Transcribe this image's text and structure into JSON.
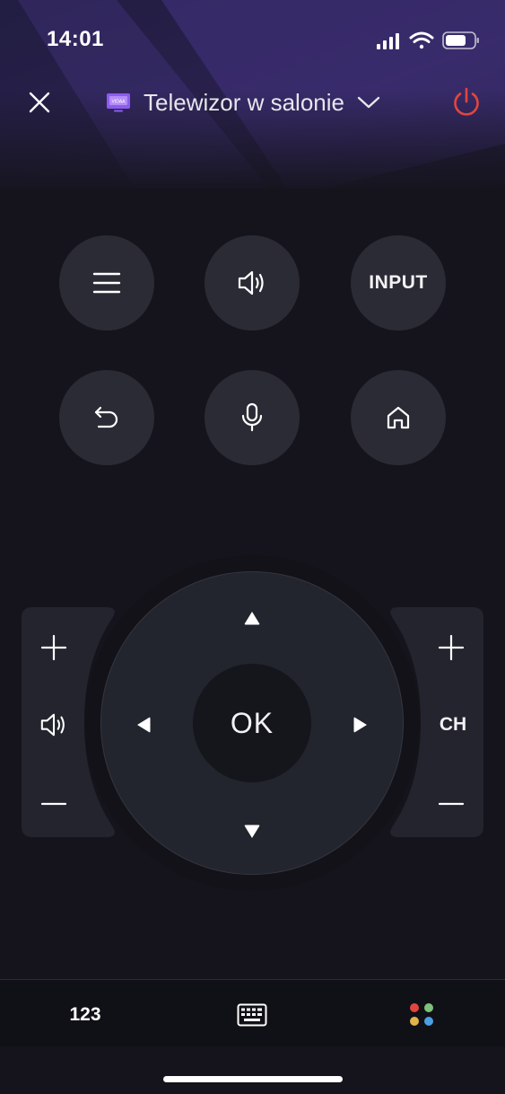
{
  "status_bar": {
    "time": "14:01"
  },
  "header": {
    "device_name": "Telewizor w salonie",
    "tv_icon_text": "VIDAA",
    "power_color": "#e0463f"
  },
  "buttons": {
    "input_label": "INPUT",
    "ok_label": "OK",
    "channel_label": "CH"
  },
  "bottom_bar": {
    "numpad_label": "123"
  },
  "colors": {
    "accent_purple": "#8c5cf0",
    "color_keys": [
      "#e0463f",
      "#7fc07a",
      "#e0b44a",
      "#4a9fe0"
    ]
  }
}
